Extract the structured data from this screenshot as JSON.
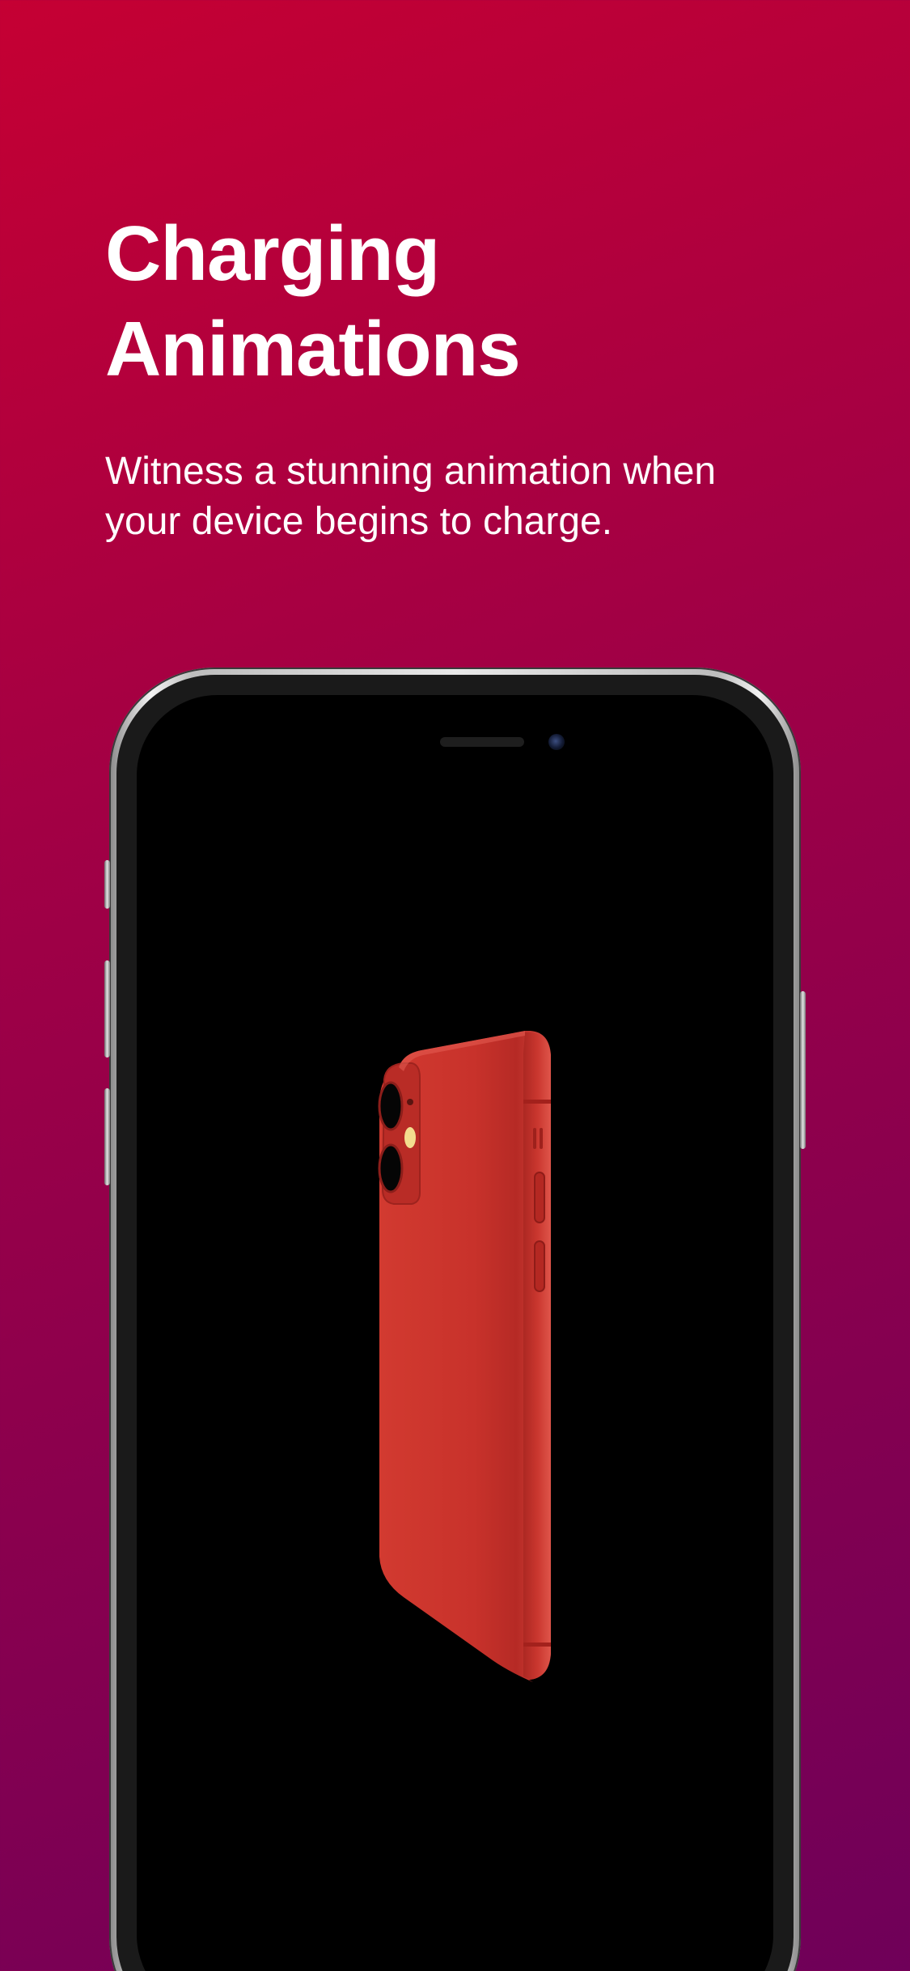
{
  "hero": {
    "title_line1": "Charging",
    "title_line2": "Animations",
    "subtitle": "Witness a stunning animation when your device begins to charge."
  },
  "colors": {
    "background_top": "#c50033",
    "background_bottom": "#6f0059",
    "text": "#ffffff",
    "product_red": "#c8322b"
  },
  "device": {
    "screen_content": "red-phone-rendering"
  }
}
